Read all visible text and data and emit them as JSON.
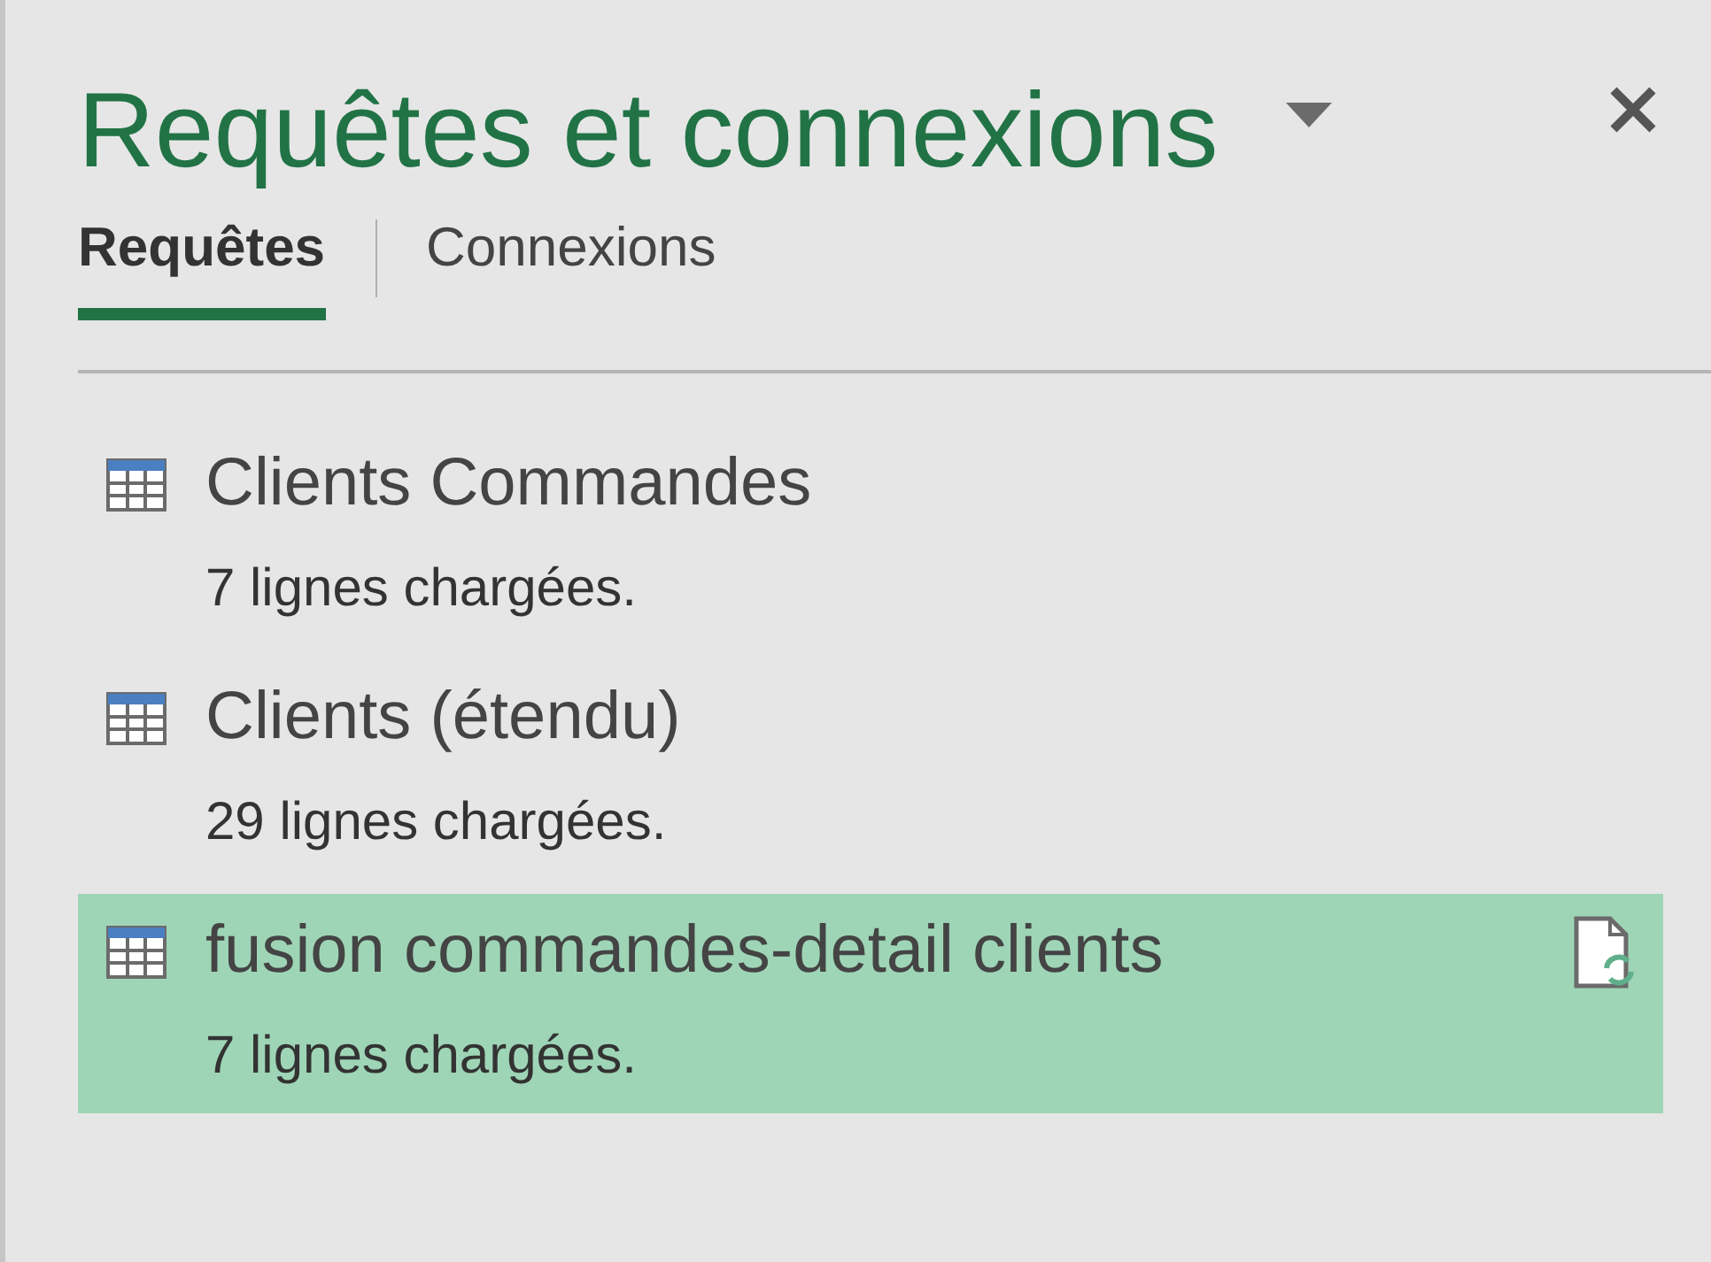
{
  "pane": {
    "title": "Requêtes et connexions"
  },
  "tabs": [
    {
      "label": "Requêtes",
      "selected": true
    },
    {
      "label": "Connexions",
      "selected": false
    }
  ],
  "queries": [
    {
      "name": "Clients Commandes",
      "detail": "7 lignes chargées.",
      "selected": false
    },
    {
      "name": "Clients (étendu)",
      "detail": "29 lignes chargées.",
      "selected": false
    },
    {
      "name": "fusion commandes-detail clients",
      "detail": "7 lignes chargées.",
      "selected": true
    }
  ]
}
